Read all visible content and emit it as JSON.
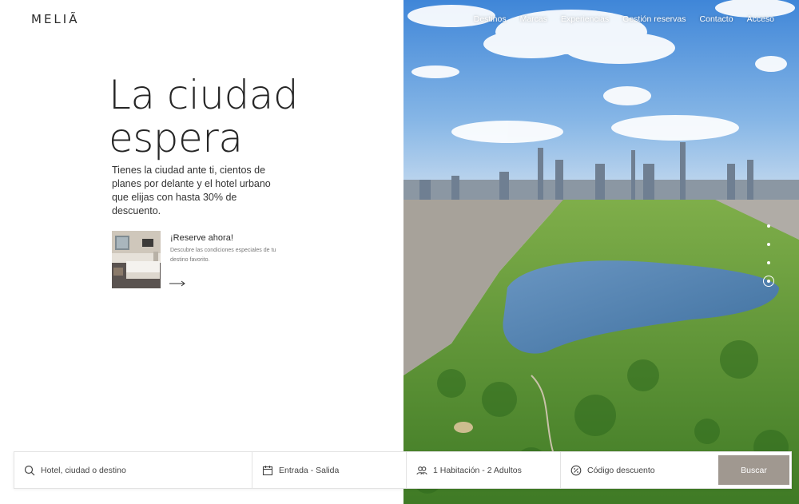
{
  "brand": {
    "logo": "MELIÃ"
  },
  "nav": {
    "items": [
      "Destinos",
      "Marcas",
      "Experiencias",
      "Gestión reservas",
      "Contacto",
      "Acceso"
    ]
  },
  "hero": {
    "title_line1": "La ciudad",
    "title_line2": "espera",
    "description": "Tienes la ciudad ante ti, cientos de planes por delante y el hotel urbano que elijas con hasta 30% de descuento."
  },
  "promo": {
    "title": "¡Reserve ahora!",
    "subtitle": "Descubre las condiciones especiales de tu destino favorito."
  },
  "carousel": {
    "slides": 4,
    "active_index": 4
  },
  "search": {
    "destination_placeholder": "Hotel, ciudad o destino",
    "dates_placeholder": "Entrada - Salida",
    "occupancy": "1 Habitación - 2 Adultos",
    "promo_code_placeholder": "Código descuento",
    "button_label": "Buscar"
  },
  "colors": {
    "accent_button": "#a09890",
    "text_dark": "#262626",
    "sky": "#4f8fd6",
    "water": "#4d7fb0",
    "park": "#5e9a3a"
  }
}
